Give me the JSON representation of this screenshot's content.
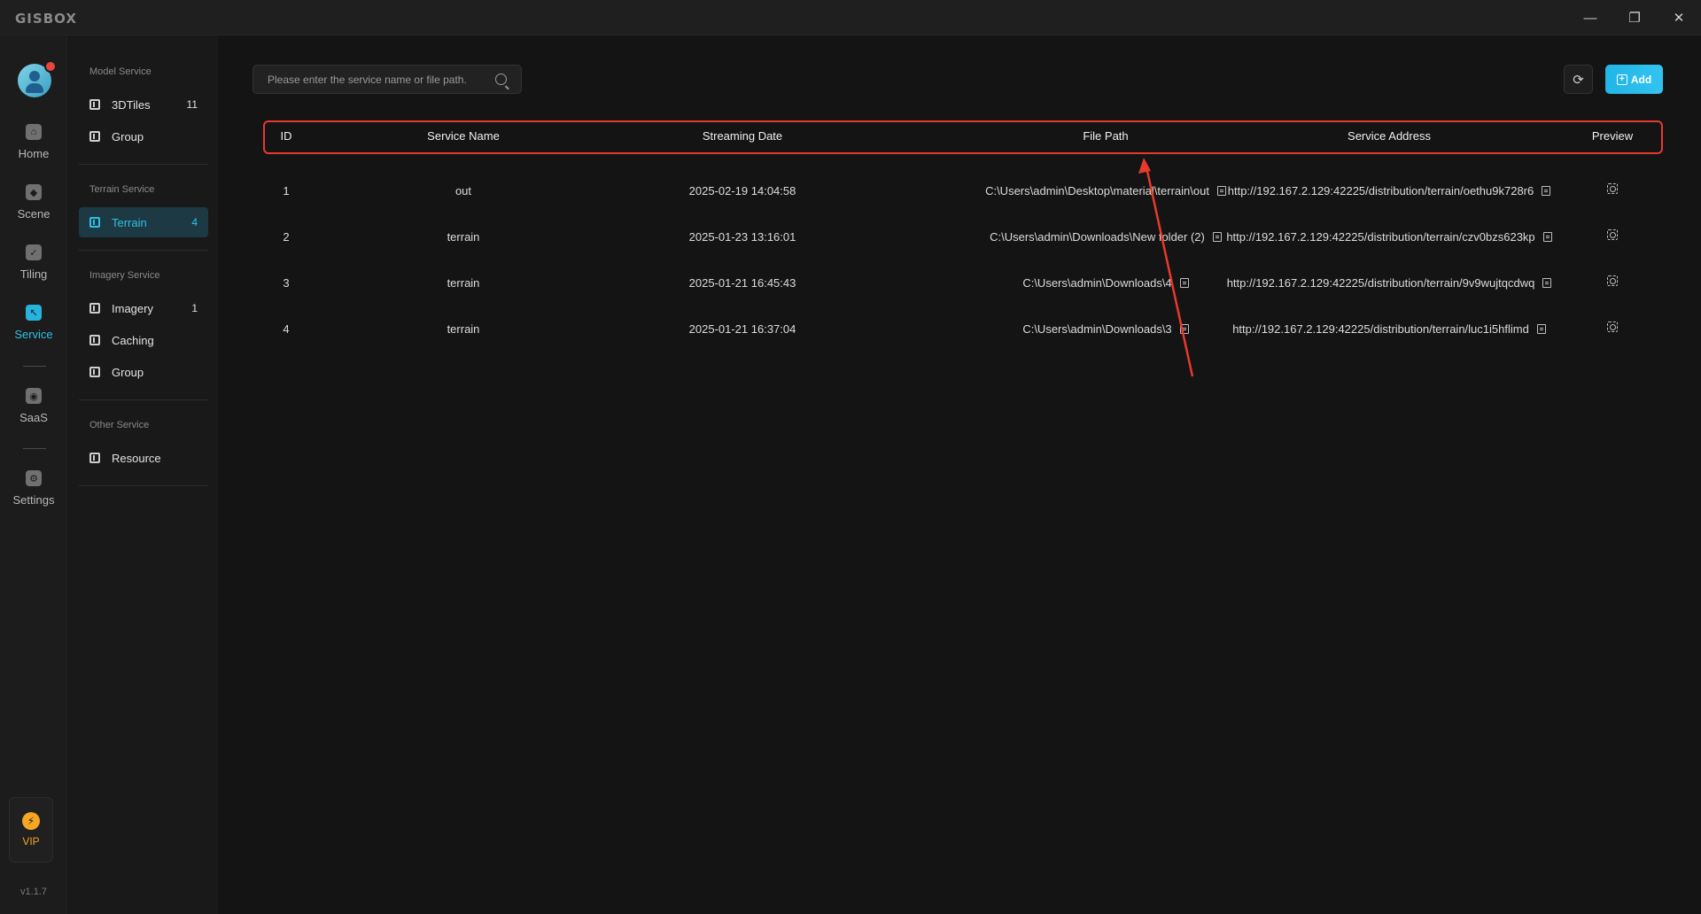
{
  "app": {
    "logo": "GISBOX",
    "window_controls": {
      "minimize": "—",
      "restore": "❐",
      "close": "✕"
    },
    "version": "v1.1.7"
  },
  "rail": {
    "items": [
      {
        "label": "Home",
        "icon": "home-icon",
        "glyph": "⌂"
      },
      {
        "label": "Scene",
        "icon": "scene-icon",
        "glyph": "◆"
      },
      {
        "label": "Tiling",
        "icon": "tiling-icon",
        "glyph": "✓"
      },
      {
        "label": "Service",
        "icon": "service-icon",
        "glyph": "↖",
        "active": true
      },
      {
        "label": "SaaS",
        "icon": "saas-icon",
        "glyph": "◉"
      },
      {
        "label": "Settings",
        "icon": "settings-icon",
        "glyph": "⚙"
      }
    ],
    "vip": {
      "label": "VIP",
      "glyph": "⚡"
    }
  },
  "subnav": {
    "sections": [
      {
        "title": "Model Service",
        "items": [
          {
            "label": "3DTiles",
            "count": "11"
          },
          {
            "label": "Group",
            "count": ""
          }
        ]
      },
      {
        "title": "Terrain Service",
        "items": [
          {
            "label": "Terrain",
            "count": "4",
            "active": true
          }
        ]
      },
      {
        "title": "Imagery Service",
        "items": [
          {
            "label": "Imagery",
            "count": "1"
          },
          {
            "label": "Caching",
            "count": ""
          },
          {
            "label": "Group",
            "count": ""
          }
        ]
      },
      {
        "title": "Other Service",
        "items": [
          {
            "label": "Resource",
            "count": ""
          }
        ]
      }
    ]
  },
  "toolbar": {
    "search_placeholder": "Please enter the service name or file path.",
    "refresh_glyph": "⟳",
    "add_label": "Add",
    "add_glyph": "+"
  },
  "table": {
    "headers": [
      "ID",
      "Service Name",
      "Streaming Date",
      "File Path",
      "Service Address",
      "Preview"
    ],
    "rows": [
      {
        "id": "1",
        "name": "out",
        "date": "2025-02-19 14:04:58",
        "path": "C:\\Users\\admin\\Desktop\\material\\terrain\\out",
        "address": "http://192.167.2.129:42225/distribution/terrain/oethu9k728r6"
      },
      {
        "id": "2",
        "name": "terrain",
        "date": "2025-01-23 13:16:01",
        "path": "C:\\Users\\admin\\Downloads\\New folder (2)",
        "address": "http://192.167.2.129:42225/distribution/terrain/czv0bzs623kp"
      },
      {
        "id": "3",
        "name": "terrain",
        "date": "2025-01-21 16:45:43",
        "path": "C:\\Users\\admin\\Downloads\\4",
        "address": "http://192.167.2.129:42225/distribution/terrain/9v9wujtqcdwq"
      },
      {
        "id": "4",
        "name": "terrain",
        "date": "2025-01-21 16:37:04",
        "path": "C:\\Users\\admin\\Downloads\\3",
        "address": "http://192.167.2.129:42225/distribution/terrain/luc1i5hflimd"
      }
    ]
  },
  "colors": {
    "accent": "#2ec0e8",
    "annotation": "#e8392d",
    "vip": "#f5a623"
  }
}
